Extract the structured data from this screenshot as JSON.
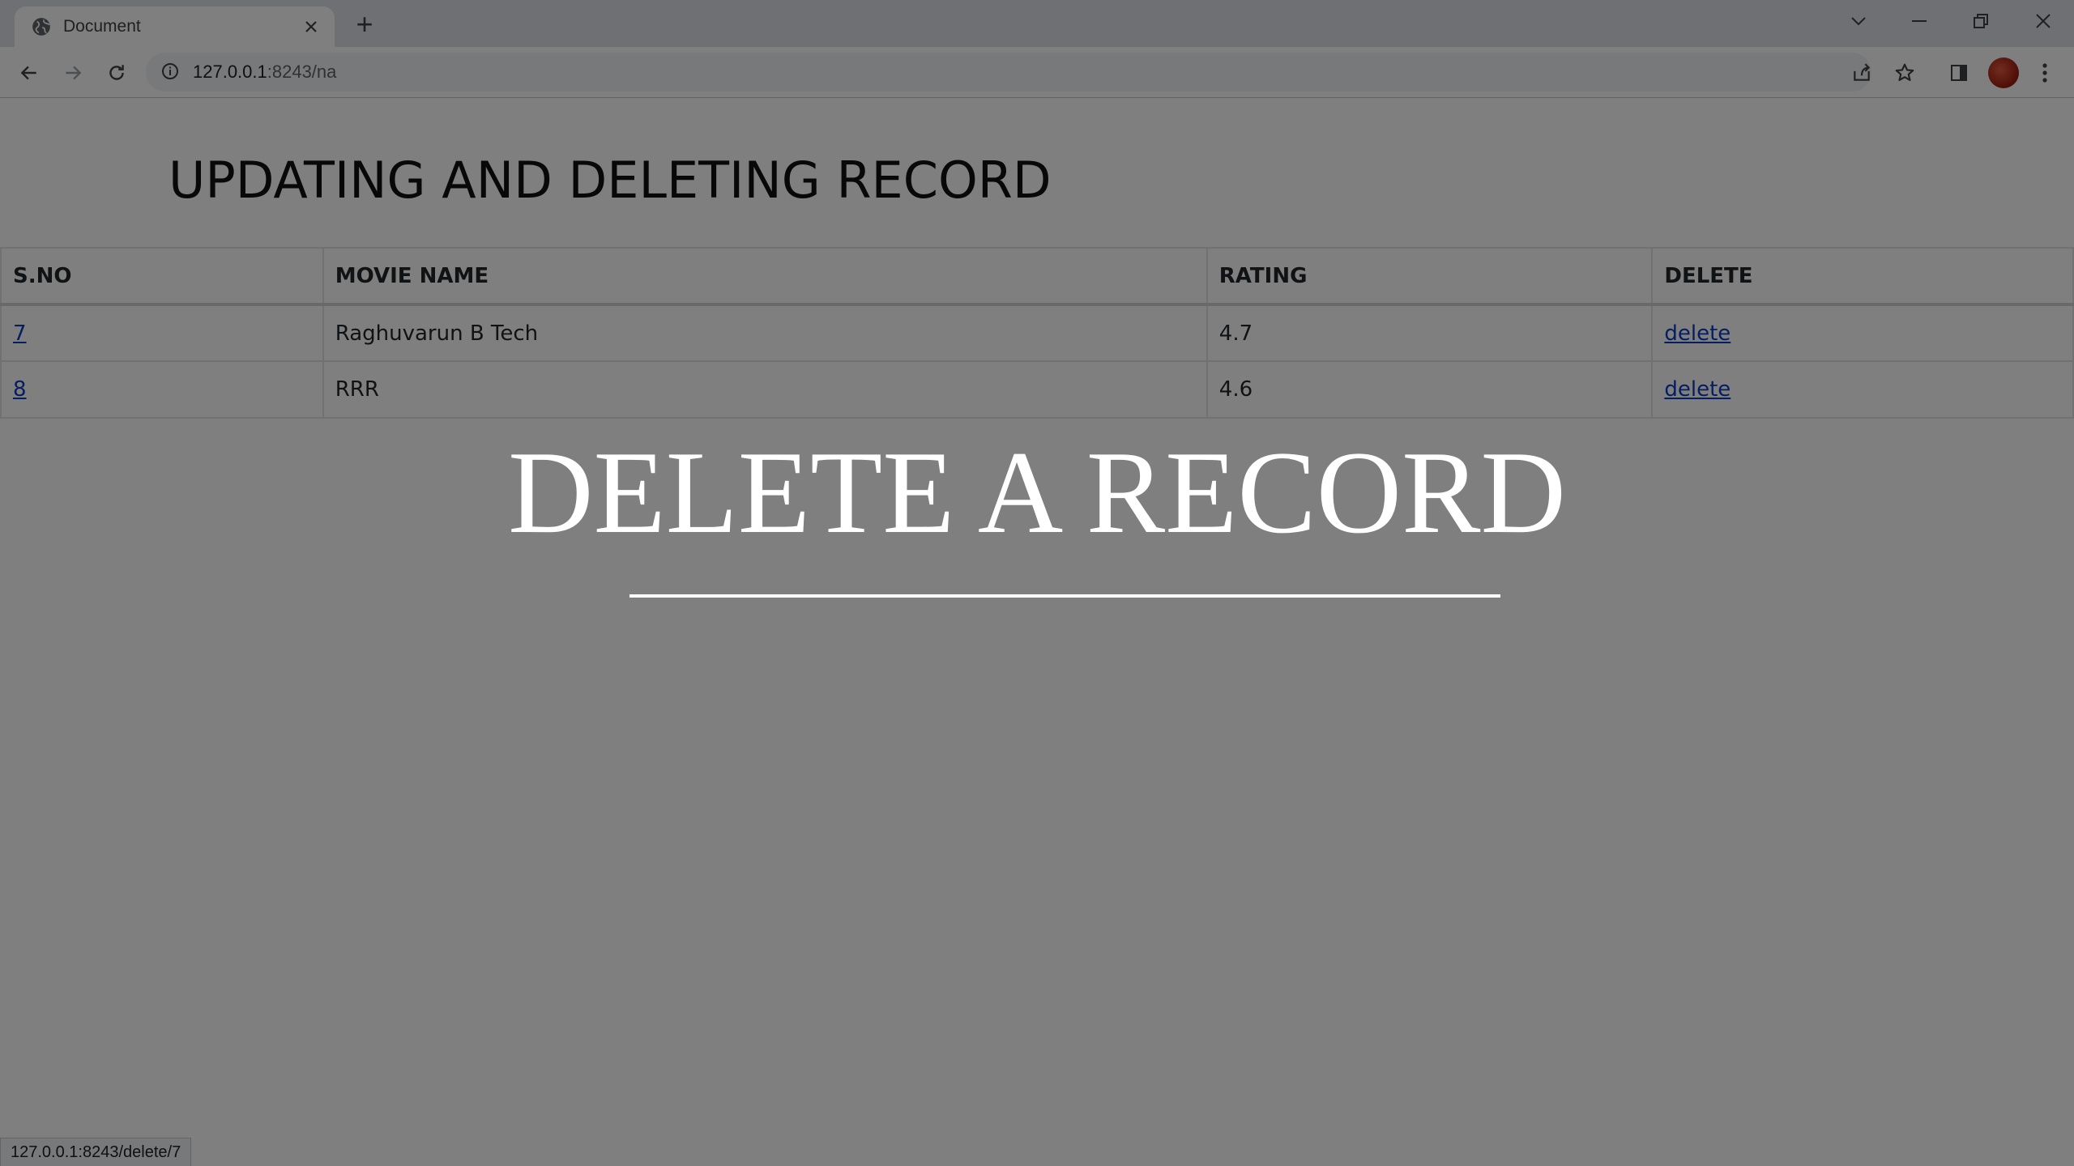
{
  "browser": {
    "tab_title": "Document",
    "new_tab": "+",
    "url_host": "127.0.0.1",
    "url_rest": ":8243/na",
    "status_url": "127.0.0.1:8243/delete/7",
    "icons": [
      "globe-icon",
      "close-icon",
      "back-icon",
      "forward-icon",
      "reload-icon",
      "info-icon",
      "share-icon",
      "star-icon",
      "side-panel-icon",
      "avatar",
      "menu-icon",
      "chevron-down-icon",
      "minimize-icon",
      "restore-icon",
      "window-close-icon"
    ]
  },
  "page": {
    "title": "UPDATING AND DELETING RECORD",
    "table": {
      "headers": [
        "S.NO",
        "MOVIE NAME",
        "RATING",
        "DELETE"
      ],
      "rows": [
        {
          "sno": "7",
          "movie": "Raghuvarun B Tech",
          "rating": "4.7",
          "delete": "delete"
        },
        {
          "sno": "8",
          "movie": "RRR",
          "rating": "4.6",
          "delete": "delete"
        }
      ]
    }
  },
  "overlay": {
    "title": "DELETE A RECORD",
    "dim_color": "#000000"
  }
}
